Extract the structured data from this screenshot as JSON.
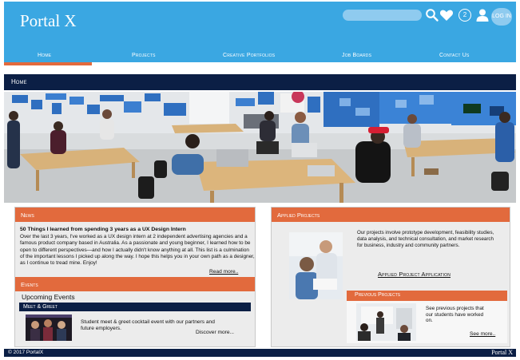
{
  "header": {
    "logo": "Portal X",
    "login_label": "LOG IN",
    "notification_count": "2",
    "icons": [
      "search-icon",
      "heart-icon",
      "user-icon"
    ]
  },
  "nav": {
    "items": [
      "Home",
      "Projects",
      "Creative Portfolios",
      "Job Boards",
      "Contact Us"
    ],
    "active": "Home"
  },
  "breadcrumb": "Home",
  "news": {
    "heading": "News",
    "title": "50 Things I learned from spending 3 years as a UX Design Intern",
    "body": "Over the last 3 years, I've worked as a UX design intern at 2 independent advertising agencies and a famous product company based in Australia. As a passionate and young beginner, I learned how to be open to different perspectives—and how I actually didn't know anything at all. This list is a culmination of the important lessons I picked up along the way. I hope this helps you in your own path as a designer, as I continue to tread mine. Enjoy!",
    "read_more": "Read more.."
  },
  "events": {
    "heading": "Events",
    "upcoming": "Upcoming Events",
    "category": "Meet & Greet",
    "description": "Student meet & greet cocktail event with our partners and future employers.",
    "discover": "Discover more..."
  },
  "applied": {
    "heading": "Applied Projects",
    "body": "Our projects involve prototype development, feasibility studies, data analysis, and technical consultation, and market research for business, industry and community partners.",
    "application_link": "Applied Project Application"
  },
  "previous": {
    "heading": "Previous Projects",
    "body": "See previous projects that our students have worked on.",
    "see_more": "See more.."
  },
  "footer": {
    "copyright": "© 2017 PortalX",
    "brand": "Portal X"
  },
  "colors": {
    "header_blue": "#3aa7e2",
    "accent_orange": "#e26a3d",
    "navy": "#0b1f45",
    "panel_gray": "#ececec"
  }
}
